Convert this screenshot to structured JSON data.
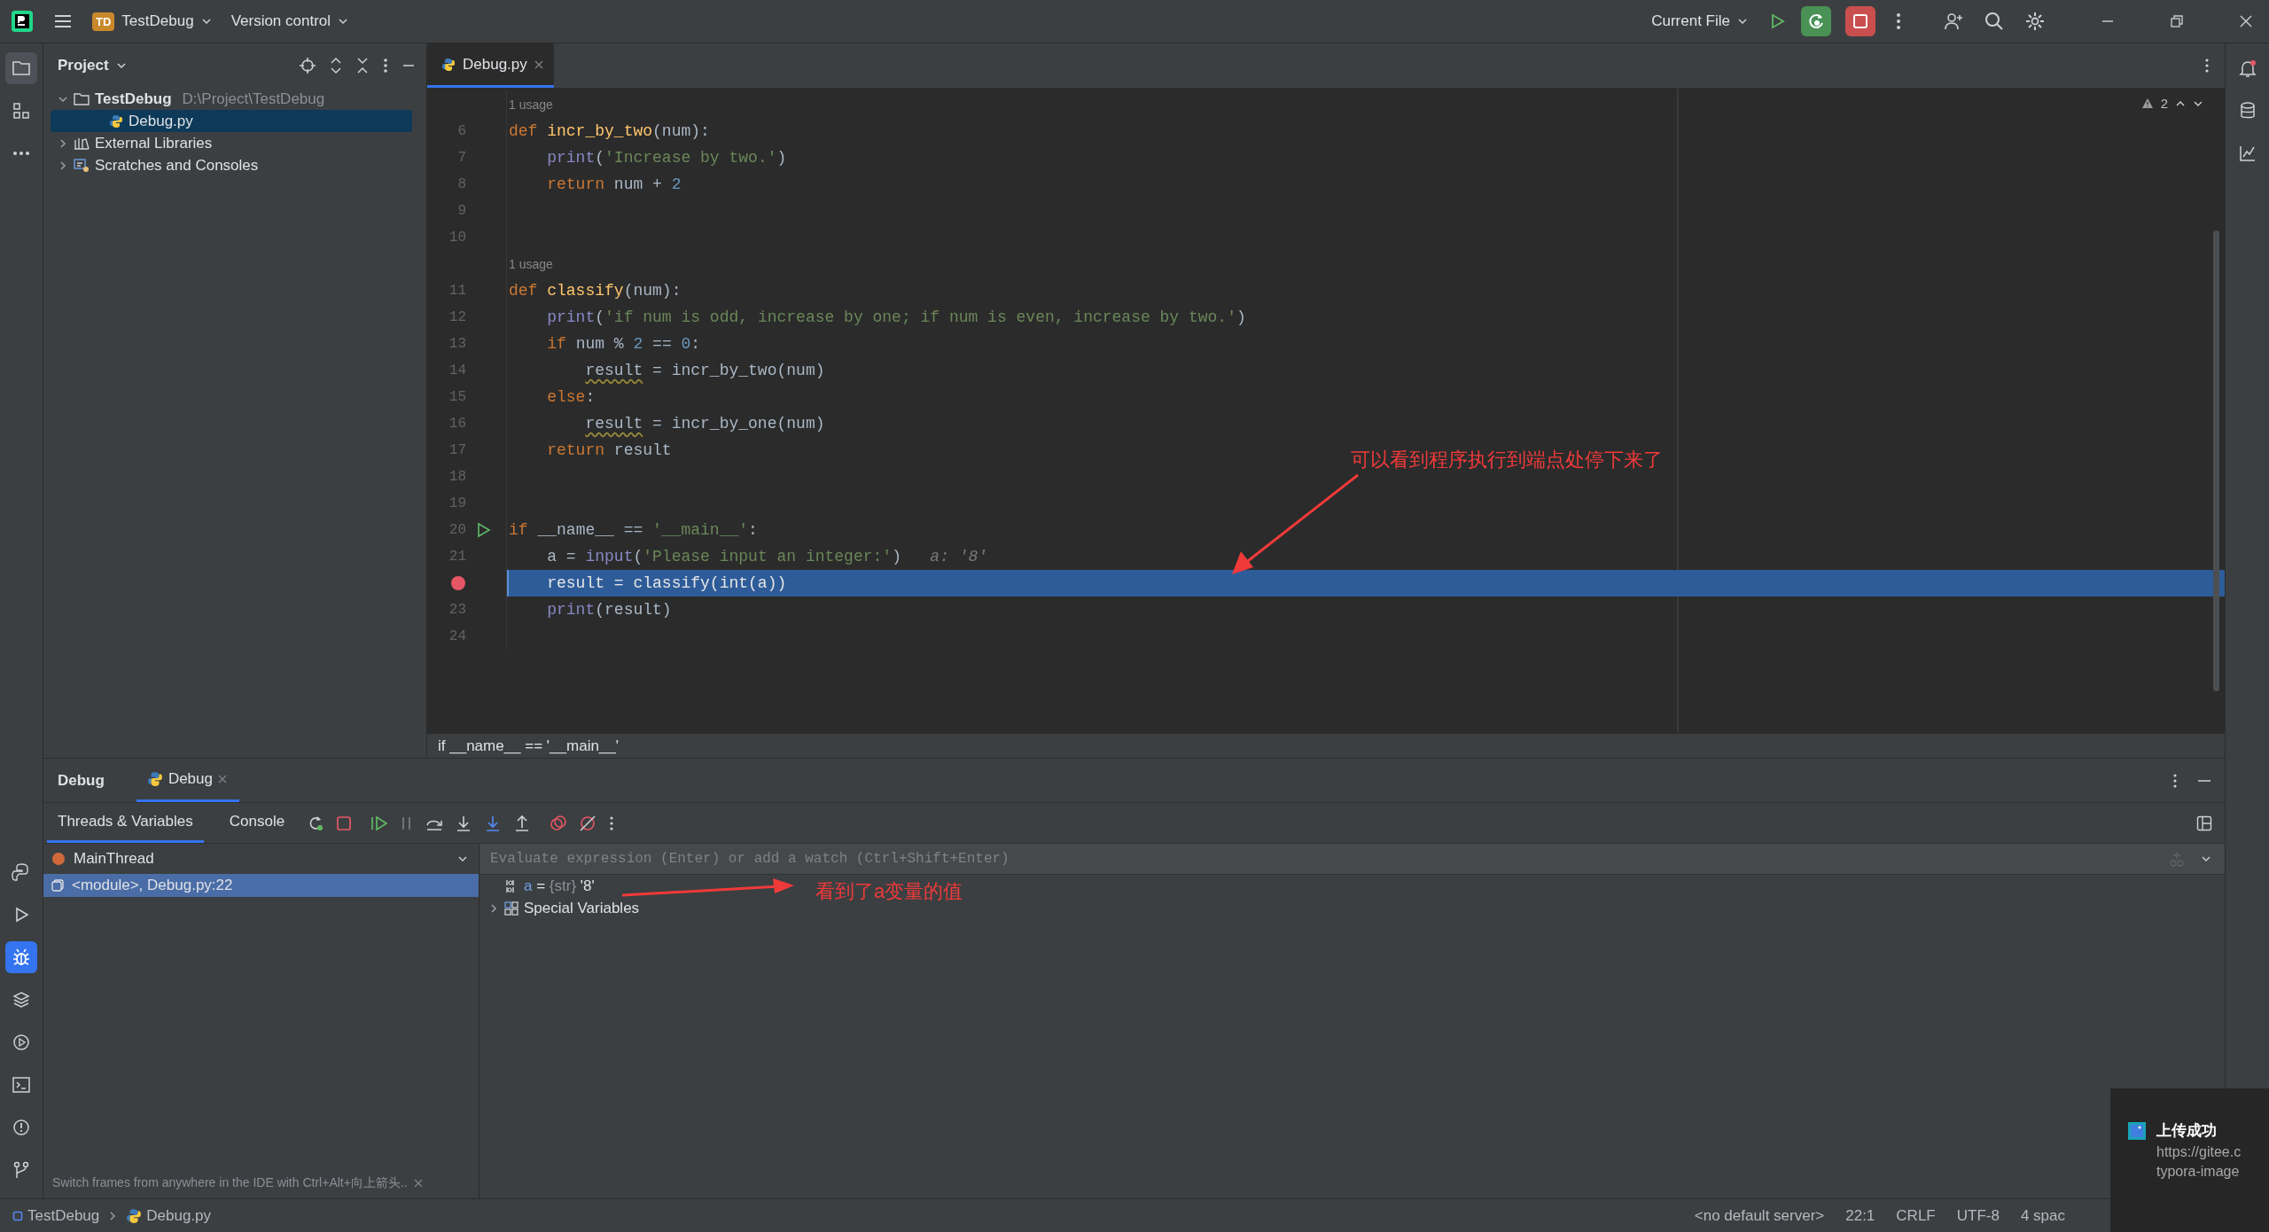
{
  "title_bar": {
    "project_badge": "TD",
    "project": "TestDebug",
    "vcs": "Version control",
    "run_config": "Current File"
  },
  "project_panel": {
    "title": "Project",
    "tree": [
      {
        "name": "TestDebug",
        "path": "D:\\Project\\TestDebug",
        "kind": "folder",
        "expanded": true,
        "selected": false,
        "children": [
          {
            "name": "Debug.py",
            "kind": "python",
            "selected": true
          }
        ]
      },
      {
        "name": "External Libraries",
        "kind": "library",
        "expanded": false,
        "selected": false
      },
      {
        "name": "Scratches and Consoles",
        "kind": "scratches",
        "expanded": false,
        "selected": false
      }
    ]
  },
  "editor": {
    "tabs": [
      {
        "label": "Debug.py",
        "selected": true
      }
    ],
    "warnings": "2",
    "lines": [
      {
        "kind": "usage",
        "text": "1 usage"
      },
      {
        "kind": "code",
        "number": "6",
        "tokens": [
          {
            "text": "def ",
            "kind": "kw"
          },
          {
            "text": "incr_by_two",
            "kind": "fn"
          },
          {
            "text": "(num):",
            "kind": "plain"
          }
        ]
      },
      {
        "kind": "code",
        "number": "7",
        "tokens": [
          {
            "text": "    print",
            "kind": "builtin"
          },
          {
            "text": "(",
            "kind": "plain"
          },
          {
            "text": "'Increase by two.'",
            "kind": "str"
          },
          {
            "text": ")",
            "kind": "plain"
          }
        ]
      },
      {
        "kind": "code",
        "number": "8",
        "tokens": [
          {
            "text": "    return",
            "kind": "kw"
          },
          {
            "text": " num + ",
            "kind": "plain"
          },
          {
            "text": "2",
            "kind": "num"
          }
        ]
      },
      {
        "kind": "code",
        "number": "9"
      },
      {
        "kind": "code",
        "number": "10"
      },
      {
        "kind": "usage",
        "text": "1 usage"
      },
      {
        "kind": "code",
        "number": "11",
        "tokens": [
          {
            "text": "def ",
            "kind": "kw"
          },
          {
            "text": "classify",
            "kind": "fn"
          },
          {
            "text": "(num):",
            "kind": "plain"
          }
        ]
      },
      {
        "kind": "code",
        "number": "12",
        "tokens": [
          {
            "text": "    print",
            "kind": "builtin"
          },
          {
            "text": "(",
            "kind": "plain"
          },
          {
            "text": "'if num is odd, increase by one; if num is even, increase by two.'",
            "kind": "str"
          },
          {
            "text": ")",
            "kind": "plain"
          }
        ]
      },
      {
        "kind": "code",
        "number": "13",
        "tokens": [
          {
            "text": "    if",
            "kind": "kw"
          },
          {
            "text": " num % ",
            "kind": "plain"
          },
          {
            "text": "2",
            "kind": "num"
          },
          {
            "text": " == ",
            "kind": "plain"
          },
          {
            "text": "0",
            "kind": "num"
          },
          {
            "text": ":",
            "kind": "plain"
          }
        ]
      },
      {
        "kind": "code",
        "number": "14",
        "tokens": [
          {
            "text": "        result",
            "kind": "warn"
          },
          {
            "text": " = incr_by_two(num)",
            "kind": "plain"
          }
        ]
      },
      {
        "kind": "code",
        "number": "15",
        "tokens": [
          {
            "text": "    else",
            "kind": "kw"
          },
          {
            "text": ":",
            "kind": "plain"
          }
        ]
      },
      {
        "kind": "code",
        "number": "16",
        "tokens": [
          {
            "text": "        result",
            "kind": "warn"
          },
          {
            "text": " = incr_by_one(num)",
            "kind": "plain"
          }
        ]
      },
      {
        "kind": "code",
        "number": "17",
        "tokens": [
          {
            "text": "    return",
            "kind": "kw"
          },
          {
            "text": " result",
            "kind": "plain"
          }
        ]
      },
      {
        "kind": "code",
        "number": "18"
      },
      {
        "kind": "code",
        "number": "19"
      },
      {
        "kind": "code",
        "number": "20",
        "run_marker": true,
        "tokens": [
          {
            "text": "if",
            "kind": "kw"
          },
          {
            "text": " __name__ == ",
            "kind": "plain"
          },
          {
            "text": "'__main__'",
            "kind": "str"
          },
          {
            "text": ":",
            "kind": "plain"
          }
        ]
      },
      {
        "kind": "code",
        "number": "21",
        "tokens": [
          {
            "text": "    a = ",
            "kind": "plain"
          },
          {
            "text": "input",
            "kind": "builtin"
          },
          {
            "text": "(",
            "kind": "plain"
          },
          {
            "text": "'Please input an integer:'",
            "kind": "str"
          },
          {
            "text": ")   ",
            "kind": "plain"
          },
          {
            "text": "a: '8'",
            "kind": "hint"
          }
        ]
      },
      {
        "kind": "code",
        "breakpoint": true,
        "current": true,
        "tokens": [
          {
            "text": "    result = classify(",
            "kind": "plain"
          },
          {
            "text": "int",
            "kind": "builtin"
          },
          {
            "text": "(a))",
            "kind": "plain"
          }
        ]
      },
      {
        "kind": "code",
        "number": "23",
        "tokens": [
          {
            "text": "    print",
            "kind": "builtin"
          },
          {
            "text": "(result)",
            "kind": "plain"
          }
        ]
      },
      {
        "kind": "code",
        "number": "24"
      }
    ],
    "breadcrumb": "if __name__ == '__main__'"
  },
  "debug": {
    "title": "Debug",
    "tabs": [
      {
        "label": "Debug",
        "selected": true
      }
    ],
    "subtabs": [
      {
        "label": "Threads & Variables",
        "selected": true
      },
      {
        "label": "Console",
        "selected": false
      }
    ],
    "thread": "MainThread",
    "frames": [
      {
        "label": "<module>, Debug.py:22",
        "selected": true
      }
    ],
    "evaluate_placeholder": "Evaluate expression (Enter) or add a watch (Ctrl+Shift+Enter)",
    "variables": [
      {
        "kind": "value",
        "name": "a",
        "op": "=",
        "type": "{str}",
        "value": "'8'"
      },
      {
        "kind": "group",
        "name": "Special Variables",
        "expanded": false
      }
    ],
    "hint": "Switch frames from anywhere in the IDE with Ctrl+Alt+向上箭头.."
  },
  "status_bar": {
    "path": [
      {
        "label": "TestDebug",
        "kind": "module"
      },
      {
        "label": "Debug.py",
        "kind": "python"
      }
    ],
    "items": [
      "<no default server>",
      "22:1",
      "CRLF",
      "UTF-8",
      "4 spac"
    ]
  },
  "notification": {
    "title": "上传成功",
    "lines": [
      "https://gitee.c",
      "typora-image"
    ]
  },
  "annotations": [
    {
      "text": "可以看到程序执行到端点处停下来了"
    },
    {
      "text": "看到了a变量的值"
    }
  ]
}
